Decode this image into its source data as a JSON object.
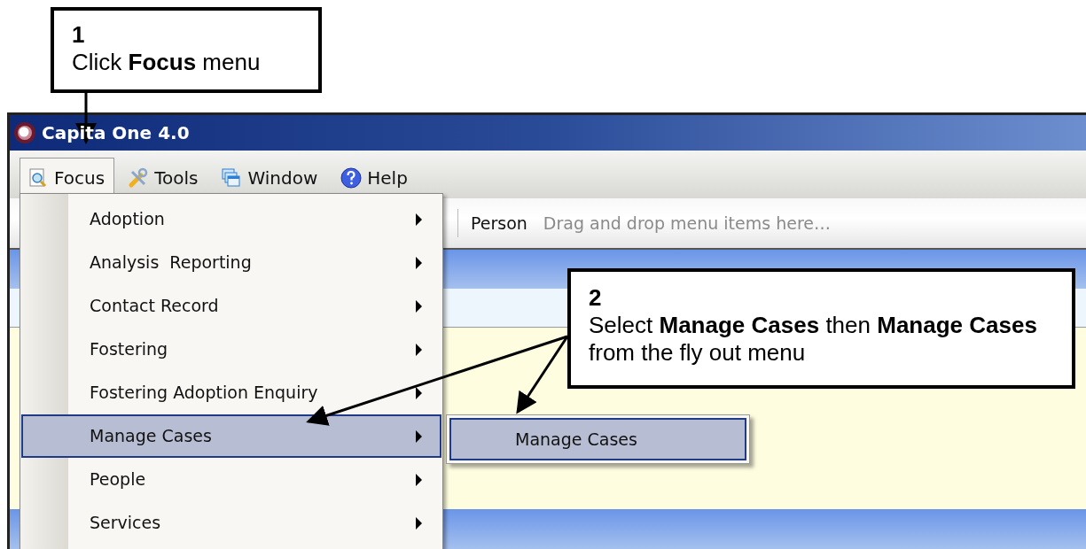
{
  "callouts": [
    {
      "number": "1",
      "text": "Click **Focus** menu"
    },
    {
      "number": "2",
      "text": "Select **Manage Cases** then **Manage Cases** from the fly out menu"
    }
  ],
  "window": {
    "title": "Capita One 4.0"
  },
  "menu_bar": [
    {
      "label": "Focus",
      "selected": true
    },
    {
      "label": "Tools",
      "selected": false
    },
    {
      "label": "Window",
      "selected": false
    },
    {
      "label": "Help",
      "selected": false
    }
  ],
  "toolbar": {
    "label": "Person",
    "hint": "Drag and drop menu items here…"
  },
  "focus_menu": {
    "items": [
      {
        "label": "Adoption",
        "selected": false,
        "has_submenu": true
      },
      {
        "label": "Analysis  Reporting",
        "selected": false,
        "has_submenu": true
      },
      {
        "label": "Contact Record",
        "selected": false,
        "has_submenu": true
      },
      {
        "label": "Fostering",
        "selected": false,
        "has_submenu": true
      },
      {
        "label": "Fostering Adoption Enquiry",
        "selected": false,
        "has_submenu": true
      },
      {
        "label": "Manage Cases",
        "selected": true,
        "has_submenu": true
      },
      {
        "label": "People",
        "selected": false,
        "has_submenu": true
      },
      {
        "label": "Services",
        "selected": false,
        "has_submenu": true
      }
    ]
  },
  "submenu": {
    "items": [
      {
        "label": "Manage Cases",
        "selected": true
      }
    ]
  }
}
